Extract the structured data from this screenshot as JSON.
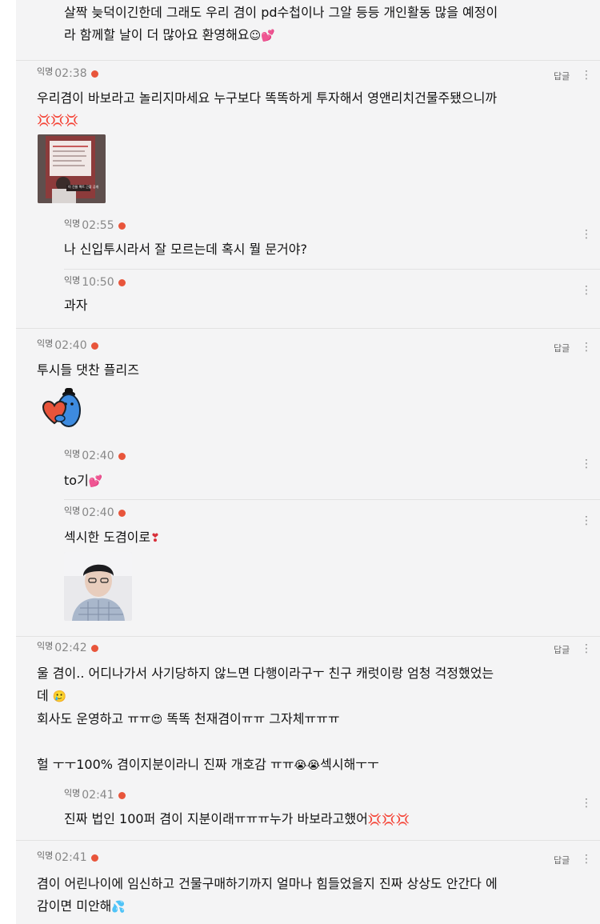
{
  "top_comment": {
    "line1": "살짝 늦덕이긴한데 그래도 우리 겸이 pd수첩이나 그알 등등 개인활동 많을 예정이",
    "line2": "라 함께할 날이 더 많아요 환영해요",
    "emoji": "☺💕"
  },
  "labels": {
    "nick": "익명",
    "reply": "답글",
    "more": "⋮"
  },
  "comments": [
    {
      "time": "02:38",
      "text": "우리겸이 바보라고 놀리지마세요 누구보다 똑똑하게 투자해서 영앤리치건물주됐으니까",
      "emoji_line": "💢💢💢",
      "image_caption": "이 건물 팩트 근황 공개",
      "replies": [
        {
          "time": "02:55",
          "text": "나 신입투시라서 잘 모르는데 혹시 뭘 문거야?"
        },
        {
          "time": "10:50",
          "text": "과자"
        }
      ]
    },
    {
      "time": "02:40",
      "text": "투시들 댓찬 플리즈",
      "replies": [
        {
          "time": "02:40",
          "text": "to기",
          "emoji": "💕"
        },
        {
          "time": "02:40",
          "text": "섹시한 도겸이로",
          "emoji": "❣"
        }
      ]
    },
    {
      "time": "02:42",
      "line1": "울 겸이.. 어디나가서 사기당하지 않느면 다행이라구ㅜ 친구 캐럿이랑 엄청 걱정했었는",
      "line2": "데",
      "line2_emoji": "🥲",
      "line3": "회사도 운영하고 ㅠㅠ",
      "line3_emoji": "😍",
      "line3_rest": " 똑똑 천재겸이ㅠㅠ 그자체ㅠㅠㅠ",
      "line4": "헐 ㅜㅜ100% 겸이지분이라니 진짜 개호감 ㅠㅠ",
      "line4_emoji": "😭😭",
      "line4_rest": "섹시해ㅜㅜ",
      "replies": [
        {
          "time": "02:41",
          "text": "진짜 법인 100퍼 겸이 지분이래ㅠㅠㅠ누가 바보라고했어",
          "emoji": "💢💢💢"
        }
      ]
    },
    {
      "time": "02:41",
      "line1": "겸이 어린나이에 임신하고 건물구매하기까지 얼마나 힘들었을지 진짜 상상도 안간다 에",
      "line2": "감이면 미안해",
      "line2_emoji": "💦"
    }
  ],
  "colors": {
    "feed_bg": "#f4f4f5",
    "badge": "#e8553b",
    "text": "#111111",
    "meta": "#888888"
  }
}
